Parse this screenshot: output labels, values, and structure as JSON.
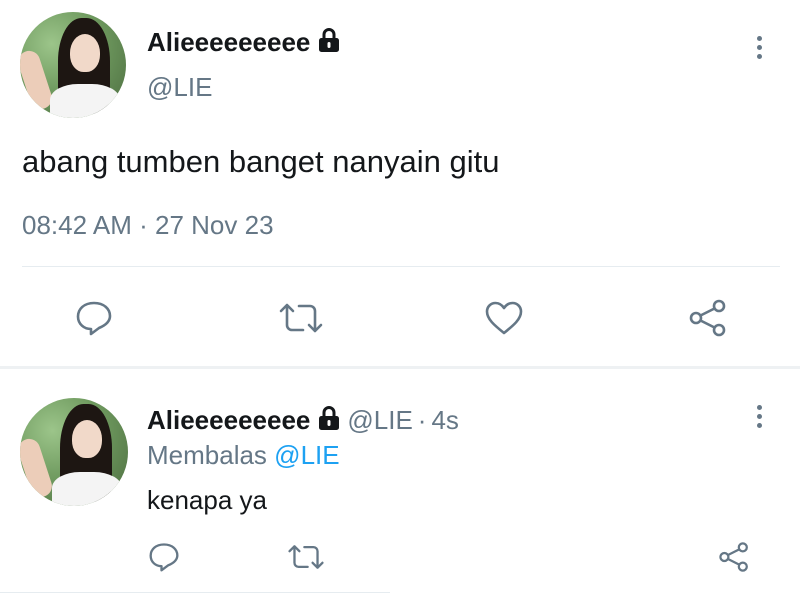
{
  "main_tweet": {
    "display_name": "Alieeeeeeeee",
    "handle": "@LIE",
    "text": "abang tumben banget nanyain gitu",
    "time": "08:42 AM",
    "separator": "·",
    "date": "27 Nov 23",
    "actions": [
      "reply-icon",
      "retweet-icon",
      "like-icon",
      "share-icon"
    ]
  },
  "reply_tweet": {
    "display_name": "Alieeeeeeeee",
    "handle": "@LIE",
    "separator": "·",
    "age": "4s",
    "replying_label": "Membalas",
    "replying_to": "@LIE",
    "text": "kenapa ya",
    "actions": [
      "reply-icon",
      "retweet-icon",
      "share-icon"
    ]
  },
  "colors": {
    "text": "#14171a",
    "muted": "#657786",
    "link": "#1da1f2",
    "divider": "#e6ecf0"
  }
}
